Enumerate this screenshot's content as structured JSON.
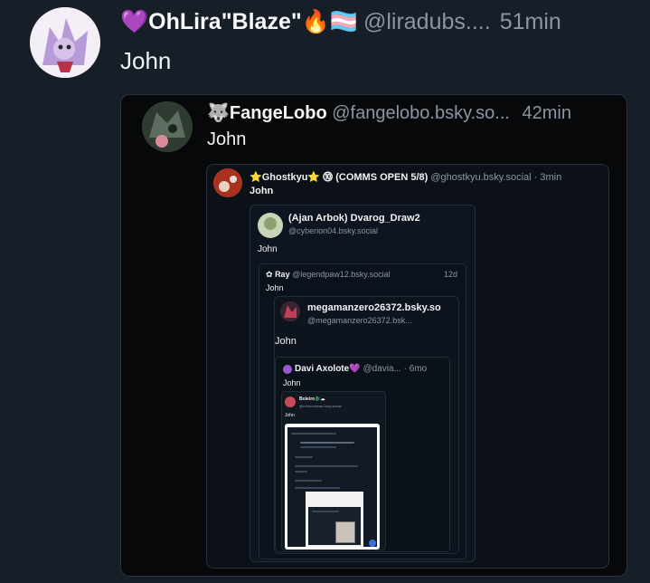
{
  "post": {
    "name": "💜OhLira\"Blaze\"🔥🏳️‍⚧️",
    "handle": "@liradubs....",
    "time": "51min",
    "text": "John"
  },
  "quote1": {
    "name": "🐺FangeLobo",
    "handle": "@fangelobo.bsky.so...",
    "time": "42min",
    "text": "John"
  },
  "quote2": {
    "name": "⭐Ghostkyu⭐ ⓾ (COMMS OPEN 5/8)",
    "handle": "@ghostkyu.bsky.social",
    "time": "· 3min",
    "text": "John"
  },
  "quote3": {
    "name": "(Ajan Arbok) Dvarog_Draw2",
    "handle": "@cyberion04.bsky.social",
    "text": "John"
  },
  "quote4": {
    "name": "Ray",
    "handle": "@legendpaw12.bsky.social",
    "time": "12d",
    "text": "John"
  },
  "quote5": {
    "name": "megamanzero26372.bsky.so",
    "handle": "@megamanzero26372.bsk...",
    "text": "John"
  },
  "quote6": {
    "name": "Davi Axolote💜",
    "handle": "@davia...",
    "time": "· 6mo",
    "text": "John"
  },
  "quote7": {
    "name": "Boleiro🐉☁",
    "handle": "@reformolinae.bsky.social",
    "text": "John"
  },
  "colors": {
    "background": "#161e27",
    "accent": "#3a6fe0"
  }
}
